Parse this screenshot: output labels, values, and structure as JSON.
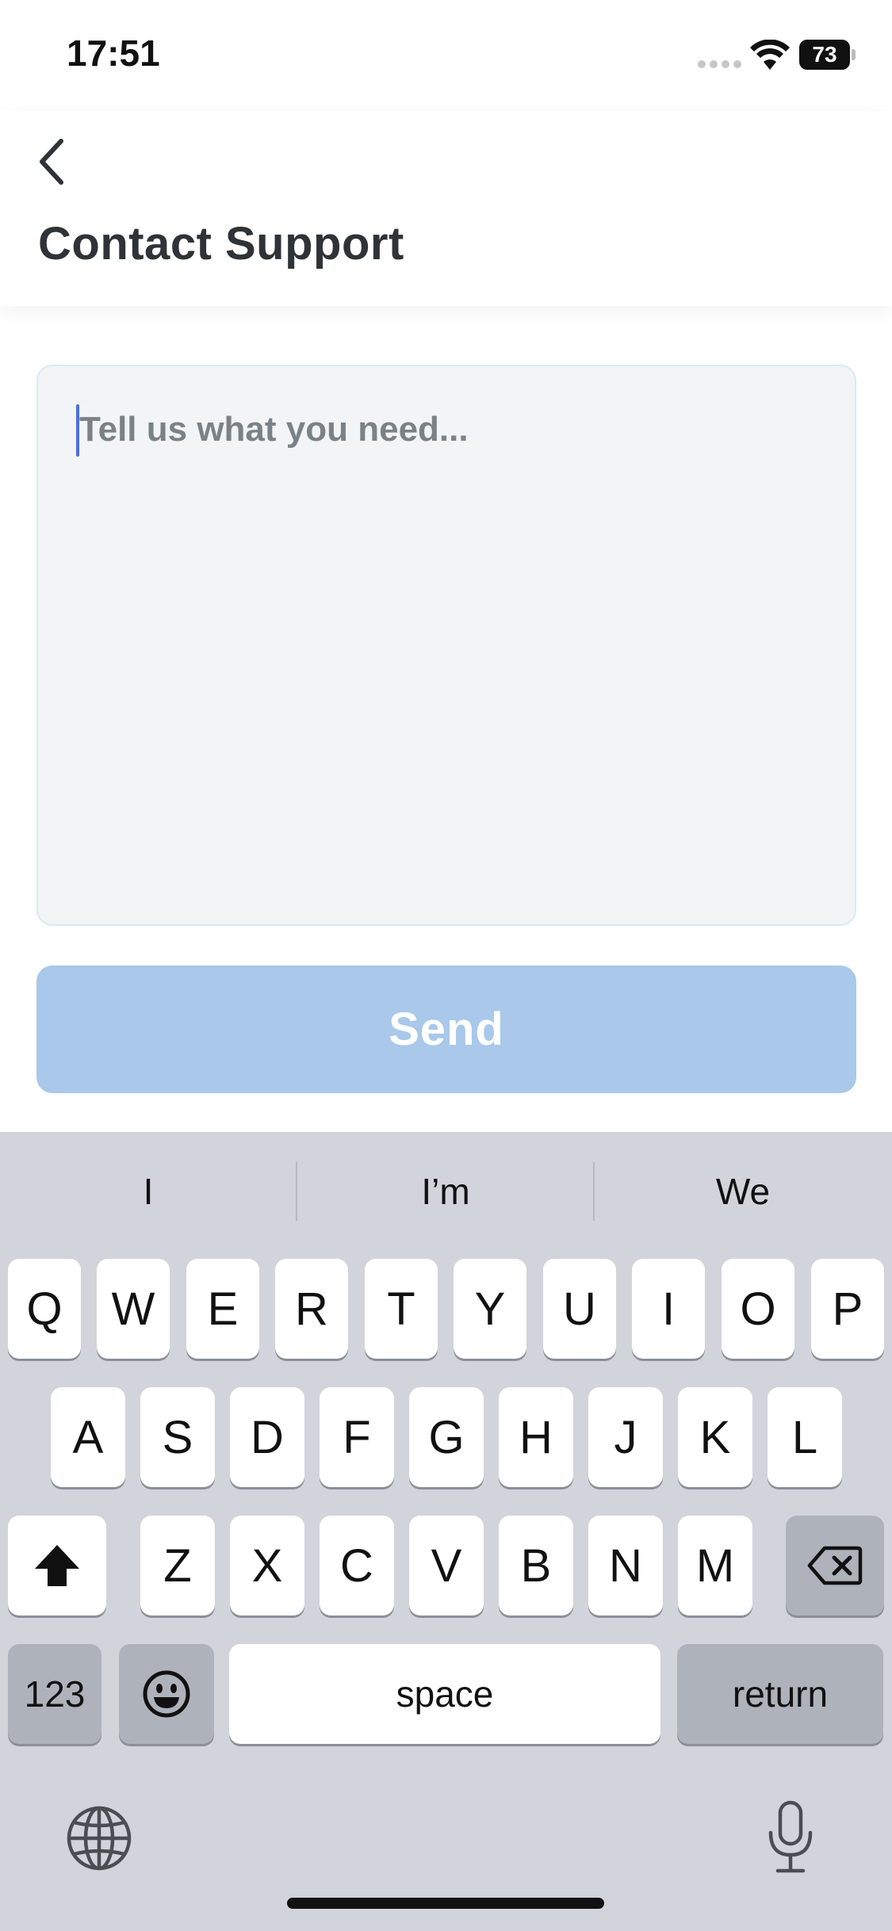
{
  "status_bar": {
    "time": "17:51",
    "battery": "73"
  },
  "header": {
    "back_icon": "chevron-left-icon",
    "title": "Contact Support"
  },
  "form": {
    "message_placeholder": "Tell us what you need...",
    "message_value": "",
    "send_label": "Send",
    "send_color": "#a9c8ea"
  },
  "keyboard": {
    "suggestions": [
      "I",
      "I’m",
      "We"
    ],
    "row1": [
      "Q",
      "W",
      "E",
      "R",
      "T",
      "Y",
      "U",
      "I",
      "O",
      "P"
    ],
    "row2": [
      "A",
      "S",
      "D",
      "F",
      "G",
      "H",
      "J",
      "K",
      "L"
    ],
    "row3": [
      "Z",
      "X",
      "C",
      "V",
      "B",
      "N",
      "M"
    ],
    "numbers_label": "123",
    "space_label": "space",
    "return_label": "return",
    "icons": {
      "shift": "shift-icon",
      "delete": "backspace-icon",
      "emoji": "emoji-icon",
      "globe": "globe-icon",
      "mic": "microphone-icon"
    }
  }
}
